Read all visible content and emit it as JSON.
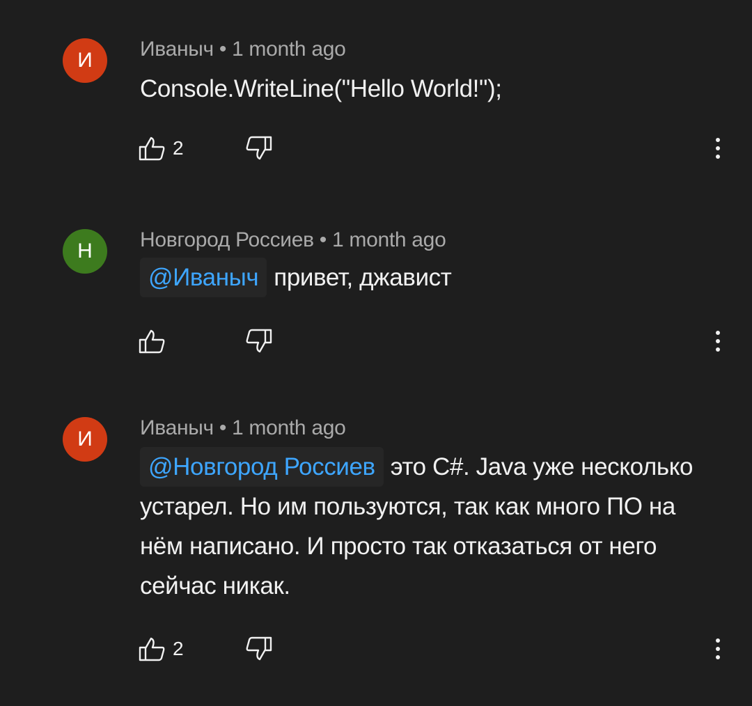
{
  "comments": [
    {
      "author": "Иваныч",
      "separator": "•",
      "time": "1 month ago",
      "avatar_letter": "И",
      "avatar_color": "#d13b14",
      "mention": "",
      "text": "Console.WriteLine(\"Hello World!\");",
      "likes": "2",
      "like_icon": "thumb-up-icon",
      "dislike_icon": "thumb-down-icon",
      "more_icon": "more-vert-icon"
    },
    {
      "author": "Новгород Россиев",
      "separator": "•",
      "time": "1 month ago",
      "avatar_letter": "Н",
      "avatar_color": "#3d7b1e",
      "mention": "@Иваныч",
      "text": "привет, джавист",
      "likes": "",
      "like_icon": "thumb-up-icon",
      "dislike_icon": "thumb-down-icon",
      "more_icon": "more-vert-icon"
    },
    {
      "author": "Иваныч",
      "separator": "•",
      "time": "1 month ago",
      "avatar_letter": "И",
      "avatar_color": "#d13b14",
      "mention": "@Новгород Россиев",
      "text": "это C#. Java уже несколько устарел. Но им пользуются, так как много ПО на нём написано. И просто так отказаться от него сейчас никак.",
      "likes": "2",
      "like_icon": "thumb-up-icon",
      "dislike_icon": "thumb-down-icon",
      "more_icon": "more-vert-icon"
    }
  ],
  "colors": {
    "background": "#1e1e1e",
    "text": "#f1f1f1",
    "meta": "#aaaaaa",
    "mention": "#3ea6ff"
  }
}
